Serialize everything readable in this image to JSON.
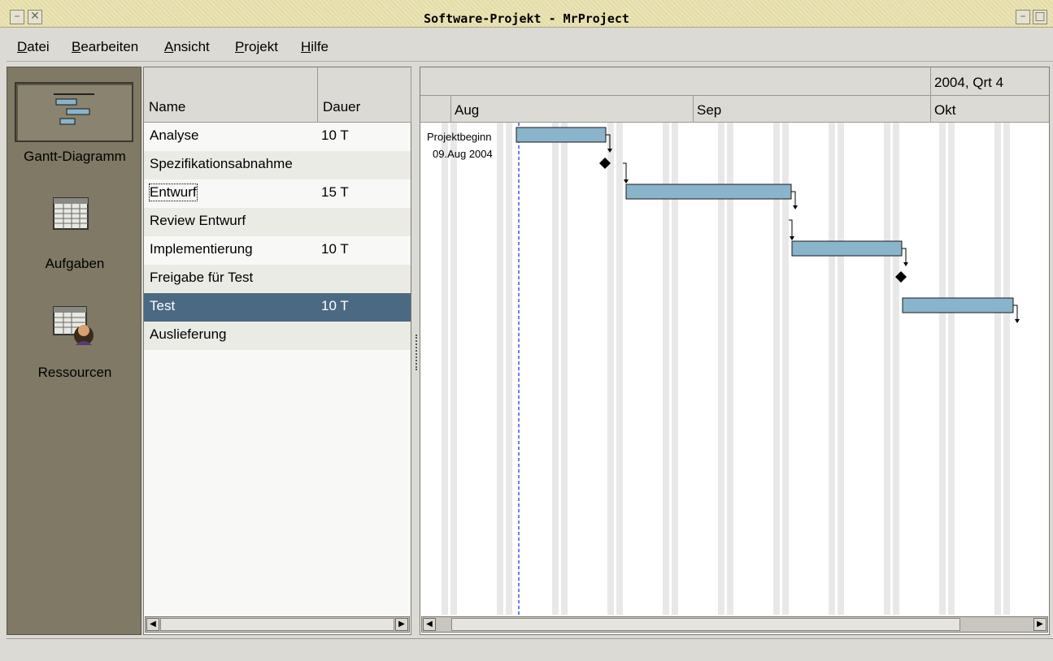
{
  "window": {
    "title": "Software-Projekt - MrProject"
  },
  "menu": [
    {
      "mnemonic": "D",
      "rest": "atei"
    },
    {
      "mnemonic": "B",
      "rest": "earbeiten"
    },
    {
      "mnemonic": "A",
      "rest": "nsicht"
    },
    {
      "mnemonic": "P",
      "rest": "rojekt"
    },
    {
      "mnemonic": "H",
      "rest": "ilfe"
    }
  ],
  "sidebar": {
    "items": [
      {
        "label": "Gantt-Diagramm",
        "icon": "gantt-icon",
        "selected": true
      },
      {
        "label": "Aufgaben",
        "icon": "tasks-table-icon",
        "selected": false
      },
      {
        "label": "Ressourcen",
        "icon": "resources-icon",
        "selected": false
      }
    ]
  },
  "table": {
    "columns": [
      "Name",
      "Dauer"
    ],
    "rows": [
      {
        "name": "Analyse",
        "duration": "10 T"
      },
      {
        "name": "Spezifikationsabnahme",
        "duration": ""
      },
      {
        "name": "Entwurf",
        "duration": "15 T"
      },
      {
        "name": "Review Entwurf",
        "duration": ""
      },
      {
        "name": "Implementierung",
        "duration": "10 T"
      },
      {
        "name": "Freigabe für Test",
        "duration": ""
      },
      {
        "name": "Test",
        "duration": "10 T"
      },
      {
        "name": "Auslieferung",
        "duration": ""
      }
    ],
    "selected_row": 6,
    "focused_row": 2
  },
  "gantt": {
    "quarter_label": "2004, Qrt 4",
    "months": [
      "Aug",
      "Sep",
      "Okt"
    ],
    "project_start_label": "Projektbeginn",
    "project_start_date": "09.Aug 2004",
    "colors": {
      "bar_fill": "#89b4cb",
      "bar_border": "#1a1a1a",
      "weekend": "#e8e8e8",
      "start_line": "#3355ff"
    }
  }
}
